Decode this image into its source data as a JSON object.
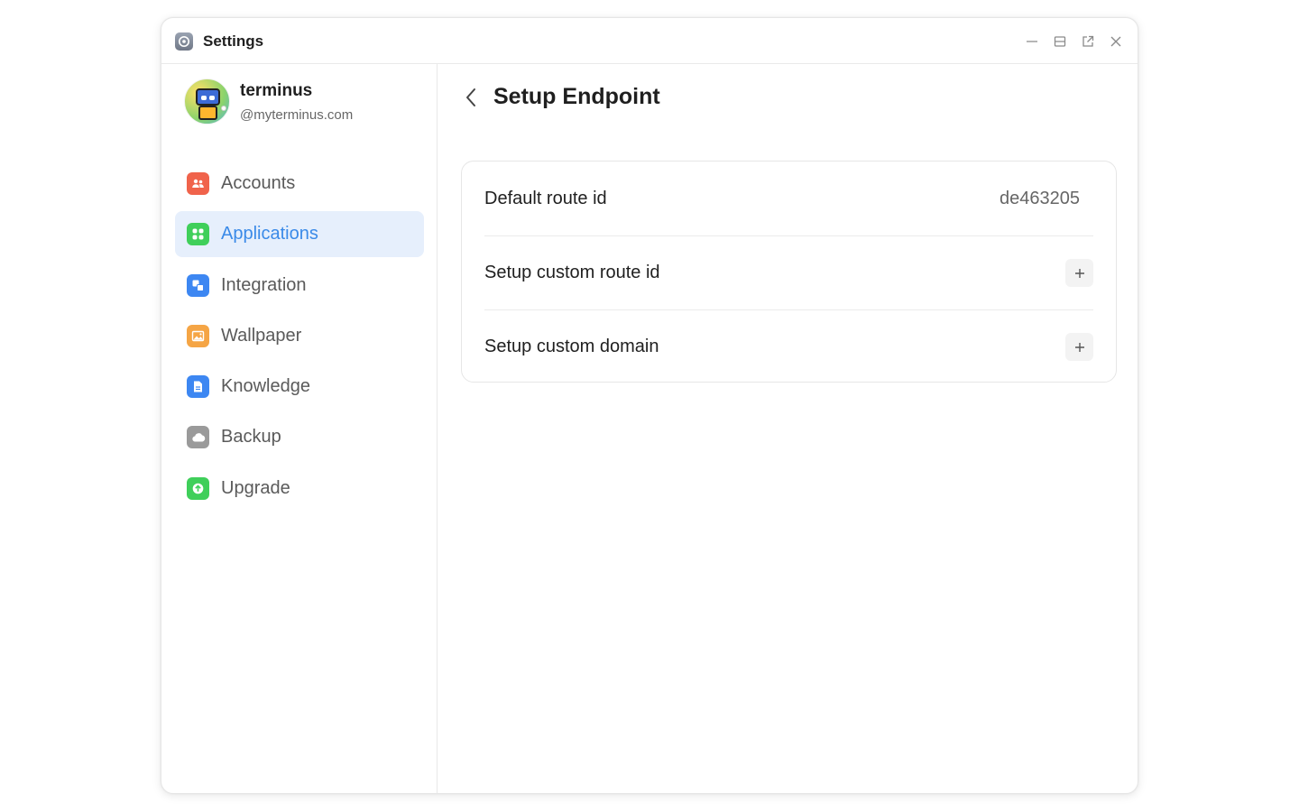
{
  "window": {
    "title": "Settings",
    "app_icon": "settings-app-icon"
  },
  "window_controls": [
    "minimize-icon",
    "maximize-icon",
    "open-external-icon",
    "close-icon"
  ],
  "profile": {
    "name": "terminus",
    "domain": "@myterminus.com"
  },
  "nav": [
    {
      "id": "accounts",
      "label": "Accounts",
      "icon": "accounts-icon",
      "color": "#f0634b",
      "active": false
    },
    {
      "id": "applications",
      "label": "Applications",
      "icon": "applications-icon",
      "color": "#3fcf5a",
      "active": true
    },
    {
      "id": "integration",
      "label": "Integration",
      "icon": "integration-icon",
      "color": "#3d87f2",
      "active": false
    },
    {
      "id": "wallpaper",
      "label": "Wallpaper",
      "icon": "wallpaper-icon",
      "color": "#f5a545",
      "active": false
    },
    {
      "id": "knowledge",
      "label": "Knowledge",
      "icon": "knowledge-icon",
      "color": "#3d87f2",
      "active": false
    },
    {
      "id": "backup",
      "label": "Backup",
      "icon": "backup-icon",
      "color": "#9a9a9a",
      "active": false
    },
    {
      "id": "upgrade",
      "label": "Upgrade",
      "icon": "upgrade-icon",
      "color": "#3fcf5a",
      "active": false
    }
  ],
  "page": {
    "title": "Setup Endpoint"
  },
  "rows": [
    {
      "label": "Default route id",
      "value": "de463205"
    },
    {
      "label": "Setup custom route id",
      "action": "plus-icon"
    },
    {
      "label": "Setup custom domain",
      "action": "plus-icon"
    }
  ],
  "colors": {
    "accent": "#3a8ae8",
    "active_bg": "#e6effc"
  }
}
